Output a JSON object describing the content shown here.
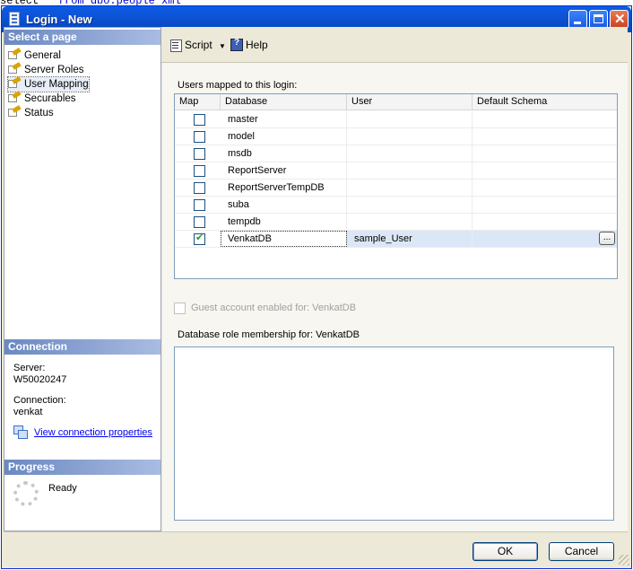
{
  "background_code": {
    "prefix": "select * ",
    "keyword": "from",
    "rest": " dbo.people xml"
  },
  "window": {
    "title": "Login - New"
  },
  "left": {
    "select_page_header": "Select a page",
    "pages": [
      {
        "label": "General"
      },
      {
        "label": "Server Roles"
      },
      {
        "label": "User Mapping",
        "selected": true
      },
      {
        "label": "Securables"
      },
      {
        "label": "Status"
      }
    ],
    "connection_header": "Connection",
    "server_label": "Server:",
    "server_value": "W50020247",
    "connection_label": "Connection:",
    "connection_value": "venkat",
    "view_props_link": "View connection properties",
    "progress_header": "Progress",
    "progress_status": "Ready"
  },
  "toolbar": {
    "script_label": "Script",
    "help_label": "Help"
  },
  "main": {
    "users_mapped_label": "Users mapped to this login:",
    "columns": [
      "Map",
      "Database",
      "User",
      "Default Schema"
    ],
    "rows": [
      {
        "map": false,
        "database": "master",
        "user": "",
        "schema": ""
      },
      {
        "map": false,
        "database": "model",
        "user": "",
        "schema": ""
      },
      {
        "map": false,
        "database": "msdb",
        "user": "",
        "schema": ""
      },
      {
        "map": false,
        "database": "ReportServer",
        "user": "",
        "schema": ""
      },
      {
        "map": false,
        "database": "ReportServerTempDB",
        "user": "",
        "schema": ""
      },
      {
        "map": false,
        "database": "suba",
        "user": "",
        "schema": ""
      },
      {
        "map": false,
        "database": "tempdb",
        "user": "",
        "schema": ""
      },
      {
        "map": true,
        "database": "VenkatDB",
        "user": "sample_User",
        "schema": ""
      }
    ],
    "ellipsis_label": "...",
    "guest_label": "Guest account enabled for: VenkatDB",
    "role_membership_label": "Database role membership for: VenkatDB"
  },
  "buttons": {
    "ok": "OK",
    "cancel": "Cancel"
  },
  "colors": {
    "title_bar": "#0a5ce6",
    "section_header": "#6b88c2",
    "check": "#21a121"
  }
}
